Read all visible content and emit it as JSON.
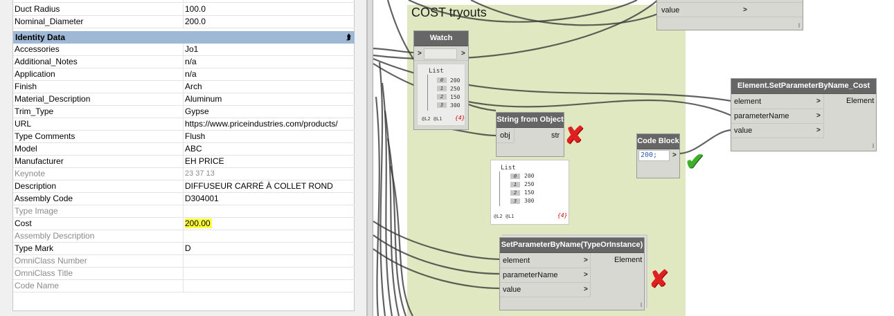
{
  "properties": {
    "top_rows": [
      {
        "name": "Duct Radius",
        "value": "100.0"
      },
      {
        "name": "Nominal_Diameter",
        "value": "200.0"
      }
    ],
    "group_header": "Identity Data",
    "rows": [
      {
        "name": "Accessories",
        "value": "Jo1"
      },
      {
        "name": "Additional_Notes",
        "value": "n/a"
      },
      {
        "name": "Application",
        "value": "n/a"
      },
      {
        "name": "Finish",
        "value": "Arch"
      },
      {
        "name": "Material_Description",
        "value": "Aluminum"
      },
      {
        "name": "Trim_Type",
        "value": "Gypse"
      },
      {
        "name": "URL",
        "value": "https://www.priceindustries.com/products/"
      },
      {
        "name": "Type Comments",
        "value": "Flush"
      },
      {
        "name": "Model",
        "value": "ABC"
      },
      {
        "name": "Manufacturer",
        "value": "EH PRICE"
      },
      {
        "name": "Keynote",
        "value": "23 37 13"
      },
      {
        "name": "Description",
        "value": "DIFFUSEUR CARRÉ À COLLET ROND"
      },
      {
        "name": "Assembly Code",
        "value": "D304001"
      },
      {
        "name": "Type Image",
        "value": ""
      },
      {
        "name": "Cost",
        "value": "200.00"
      },
      {
        "name": "Assembly Description",
        "value": ""
      },
      {
        "name": "Type Mark",
        "value": "D"
      },
      {
        "name": "OmniClass Number",
        "value": ""
      },
      {
        "name": "OmniClass Title",
        "value": ""
      },
      {
        "name": "Code Name",
        "value": ""
      }
    ]
  },
  "canvas": {
    "group_title": "COST tryouts",
    "top_node": {
      "port": "value",
      "arrow": ">",
      "pipe": "l"
    },
    "watch": {
      "title": "Watch",
      "in_arrow": ">",
      "out_arrow": ">",
      "list_label": "List",
      "items": [
        {
          "i": "0",
          "v": "200"
        },
        {
          "i": "1",
          "v": "250"
        },
        {
          "i": "2",
          "v": "150"
        },
        {
          "i": "3",
          "v": "300"
        }
      ],
      "levels": "@L2 @L1",
      "count": "{4}"
    },
    "string_from_object": {
      "title": "String from Object",
      "in": "obj",
      "out": "str"
    },
    "sfo_preview": {
      "list_label": "List",
      "items": [
        {
          "i": "0",
          "v": "200"
        },
        {
          "i": "1",
          "v": "250"
        },
        {
          "i": "2",
          "v": "150"
        },
        {
          "i": "3",
          "v": "300"
        }
      ],
      "levels": "@L2 @L1",
      "count": "{4}"
    },
    "code_block": {
      "title": "Code Block",
      "code": "200;",
      "arrow": ">"
    },
    "set_cost": {
      "title": "Element.SetParameterByName_Cost",
      "inputs": [
        "element",
        "parameterName",
        "value"
      ],
      "output": "Element",
      "arrow": ">",
      "pipe": "l"
    },
    "set_type": {
      "title": "SetParameterByName(TypeOrInstance)",
      "inputs": [
        "element",
        "parameterName",
        "value"
      ],
      "output": "Element",
      "arrow": ">",
      "pipe": "l"
    },
    "marks": {
      "cross": "✘",
      "check": "✔"
    },
    "colors": {
      "group_bg": "#dfe8c0",
      "node_header": "#666666",
      "node_body": "#d8d8d3",
      "highlight": "#ffff40",
      "header_bar": "#9fb8d6"
    }
  }
}
